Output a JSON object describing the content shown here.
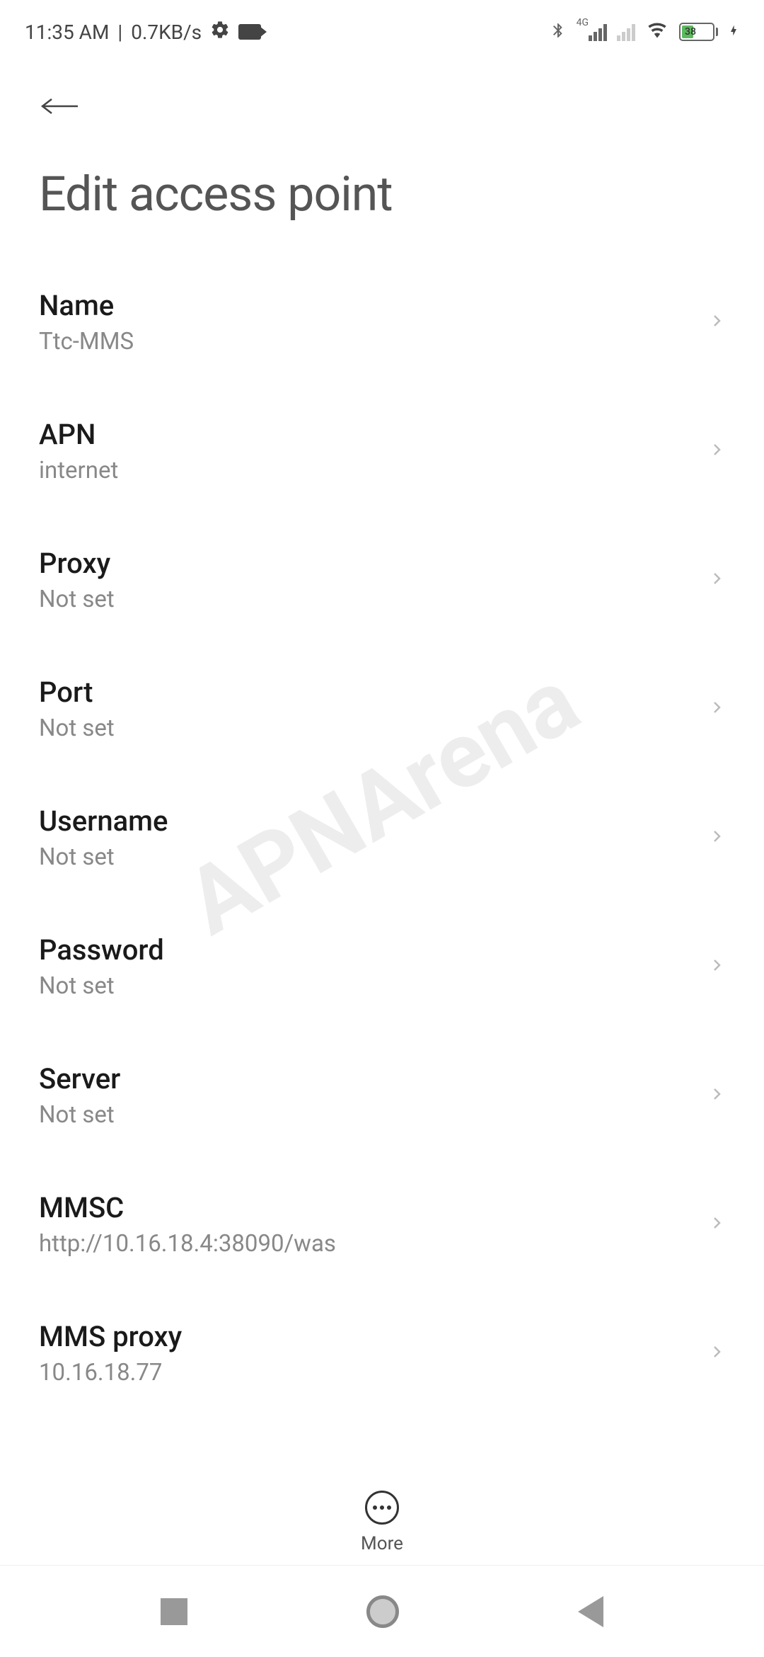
{
  "status_bar": {
    "time": "11:35 AM",
    "data_rate": "0.7KB/s",
    "battery_percent": "38",
    "network_type": "4G"
  },
  "header": {
    "title": "Edit access point"
  },
  "settings": [
    {
      "label": "Name",
      "value": "Ttc-MMS"
    },
    {
      "label": "APN",
      "value": "internet"
    },
    {
      "label": "Proxy",
      "value": "Not set"
    },
    {
      "label": "Port",
      "value": "Not set"
    },
    {
      "label": "Username",
      "value": "Not set"
    },
    {
      "label": "Password",
      "value": "Not set"
    },
    {
      "label": "Server",
      "value": "Not set"
    },
    {
      "label": "MMSC",
      "value": "http://10.16.18.4:38090/was"
    },
    {
      "label": "MMS proxy",
      "value": "10.16.18.77"
    }
  ],
  "bottom_action": {
    "label": "More"
  },
  "watermark": "APNArena"
}
